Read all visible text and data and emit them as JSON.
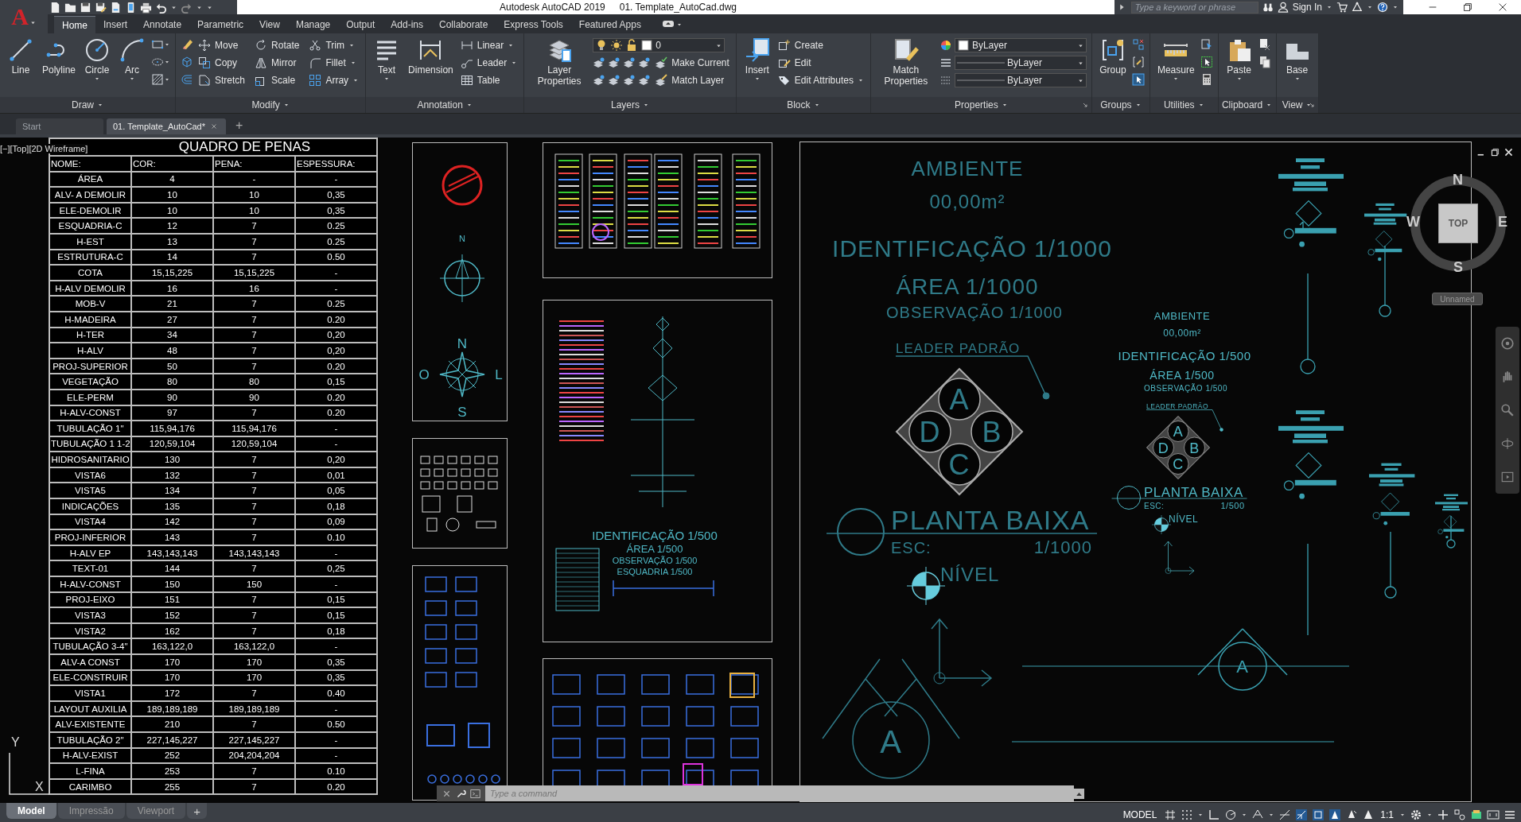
{
  "app_button": {
    "label": "A"
  },
  "title_bar": {
    "app_title": "Autodesk AutoCAD 2019",
    "document": "01. Template_AutoCad.dwg",
    "search": {
      "placeholder": "Type a keyword or phrase"
    },
    "sign_in": "Sign In"
  },
  "ribbon_tabs": [
    {
      "label": "Home",
      "selected": true
    },
    {
      "label": "Insert",
      "selected": false
    },
    {
      "label": "Annotate",
      "selected": false
    },
    {
      "label": "Parametric",
      "selected": false
    },
    {
      "label": "View",
      "selected": false
    },
    {
      "label": "Manage",
      "selected": false
    },
    {
      "label": "Output",
      "selected": false
    },
    {
      "label": "Add-ins",
      "selected": false
    },
    {
      "label": "Collaborate",
      "selected": false
    },
    {
      "label": "Express Tools",
      "selected": false
    },
    {
      "label": "Featured Apps",
      "selected": false
    }
  ],
  "ribbon_panels": [
    {
      "title": "Draw",
      "tools": [
        {
          "kind": "large",
          "label": "Line",
          "dropdown": false
        },
        {
          "kind": "large",
          "label": "Polyline",
          "dropdown": false
        },
        {
          "kind": "large",
          "label": "Circle",
          "dropdown": true
        },
        {
          "kind": "large",
          "label": "Arc",
          "dropdown": true
        }
      ]
    },
    {
      "title": "Modify",
      "tools": [
        {
          "kind": "small",
          "label": "Move",
          "dropdown": false
        },
        {
          "kind": "small",
          "label": "Rotate",
          "dropdown": false
        },
        {
          "kind": "small",
          "label": "Trim",
          "dropdown": true
        },
        {
          "kind": "small",
          "label": "Copy",
          "dropdown": false
        },
        {
          "kind": "small",
          "label": "Mirror",
          "dropdown": false
        },
        {
          "kind": "small",
          "label": "Fillet",
          "dropdown": true
        },
        {
          "kind": "small",
          "label": "Stretch",
          "dropdown": false
        },
        {
          "kind": "small",
          "label": "Scale",
          "dropdown": false
        },
        {
          "kind": "small",
          "label": "Array",
          "dropdown": true
        }
      ]
    },
    {
      "title": "Annotation",
      "tools": [
        {
          "kind": "large",
          "label": "Text",
          "dropdown": true
        },
        {
          "kind": "large",
          "label": "Dimension",
          "dropdown": false
        },
        {
          "kind": "small",
          "label": "Linear",
          "dropdown": true
        },
        {
          "kind": "small",
          "label": "Leader",
          "dropdown": true
        },
        {
          "kind": "small",
          "label": "Table",
          "dropdown": false
        }
      ]
    },
    {
      "title": "Layers",
      "tools": [
        {
          "kind": "large",
          "label": "Layer Properties",
          "dropdown": false
        },
        {
          "kind": "combo",
          "value": "0"
        },
        {
          "kind": "small",
          "label": "Make Current",
          "dropdown": false
        },
        {
          "kind": "small",
          "label": "Match Layer",
          "dropdown": false
        }
      ]
    },
    {
      "title": "Block",
      "tools": [
        {
          "kind": "large",
          "label": "Insert",
          "dropdown": true
        },
        {
          "kind": "small",
          "label": "Create",
          "dropdown": false
        },
        {
          "kind": "small",
          "label": "Edit",
          "dropdown": false
        },
        {
          "kind": "small",
          "label": "Edit Attributes",
          "dropdown": true
        }
      ]
    },
    {
      "title": "Properties",
      "tools": [
        {
          "kind": "large",
          "label": "Match Properties",
          "dropdown": false
        },
        {
          "kind": "combo",
          "value": "ByLayer"
        },
        {
          "kind": "combo",
          "value": "ByLayer"
        },
        {
          "kind": "combo",
          "value": "ByLayer"
        }
      ]
    },
    {
      "title": "Groups",
      "tools": [
        {
          "kind": "large",
          "label": "Group",
          "dropdown": false
        }
      ]
    },
    {
      "title": "Utilities",
      "tools": [
        {
          "kind": "large",
          "label": "Measure",
          "dropdown": true
        }
      ]
    },
    {
      "title": "Clipboard",
      "tools": [
        {
          "kind": "large",
          "label": "Paste",
          "dropdown": true
        }
      ]
    },
    {
      "title": "View",
      "tools": [
        {
          "kind": "large",
          "label": "Base",
          "dropdown": true
        }
      ]
    }
  ],
  "document_tabs": [
    {
      "label": "Start",
      "selected": false,
      "closable": false
    },
    {
      "label": "01. Template_AutoCad*",
      "selected": true,
      "closable": true
    }
  ],
  "new_tab": "+",
  "viewport_label": "[−][Top][2D Wireframe]",
  "table": {
    "title": "QUADRO DE PENAS",
    "columns": [
      "NOME:",
      "COR:",
      "PENA:",
      "ESPESSURA:"
    ],
    "rows": [
      {
        "nome": "ÁREA",
        "cor": "4",
        "pena": "-",
        "espessura": "-"
      },
      {
        "nome": "ALV- A DEMOLIR",
        "cor": "10",
        "pena": "10",
        "espessura": "0,35"
      },
      {
        "nome": "ELE-DEMOLIR",
        "cor": "10",
        "pena": "10",
        "espessura": "0,35"
      },
      {
        "nome": "ESQUADRIA-C",
        "cor": "12",
        "pena": "7",
        "espessura": "0.25"
      },
      {
        "nome": "H-EST",
        "cor": "13",
        "pena": "7",
        "espessura": "0.25"
      },
      {
        "nome": "ESTRUTURA-C",
        "cor": "14",
        "pena": "7",
        "espessura": "0.50"
      },
      {
        "nome": "COTA",
        "cor": "15,15,225",
        "pena": "15,15,225",
        "espessura": "-"
      },
      {
        "nome": "H-ALV DEMOLIR",
        "cor": "16",
        "pena": "16",
        "espessura": "-"
      },
      {
        "nome": "MOB-V",
        "cor": "21",
        "pena": "7",
        "espessura": "0.25"
      },
      {
        "nome": "H-MADEIRA",
        "cor": "27",
        "pena": "7",
        "espessura": "0.20"
      },
      {
        "nome": "H-TER",
        "cor": "34",
        "pena": "7",
        "espessura": "0,20"
      },
      {
        "nome": "H-ALV",
        "cor": "48",
        "pena": "7",
        "espessura": "0,20"
      },
      {
        "nome": "PROJ-SUPERIOR",
        "cor": "50",
        "pena": "7",
        "espessura": "0.20"
      },
      {
        "nome": "VEGETAÇÃO",
        "cor": "80",
        "pena": "80",
        "espessura": "0,15"
      },
      {
        "nome": "ELE-PERM",
        "cor": "90",
        "pena": "90",
        "espessura": "0.20"
      },
      {
        "nome": "H-ALV-CONST",
        "cor": "97",
        "pena": "7",
        "espessura": "0.20"
      },
      {
        "nome": "TUBULAÇÃO 1\"",
        "cor": "115,94,176",
        "pena": "115,94,176",
        "espessura": "-"
      },
      {
        "nome": "TUBULAÇÃO 1 1-2",
        "cor": "120,59,104",
        "pena": "120,59,104",
        "espessura": "-"
      },
      {
        "nome": "HIDROSANITARIO",
        "cor": "130",
        "pena": "7",
        "espessura": "0,20"
      },
      {
        "nome": "VISTA6",
        "cor": "132",
        "pena": "7",
        "espessura": "0,01"
      },
      {
        "nome": "VISTA5",
        "cor": "134",
        "pena": "7",
        "espessura": "0,05"
      },
      {
        "nome": "INDICAÇÕES",
        "cor": "135",
        "pena": "7",
        "espessura": "0,18"
      },
      {
        "nome": "VISTA4",
        "cor": "142",
        "pena": "7",
        "espessura": "0,09"
      },
      {
        "nome": "PROJ-INFERIOR",
        "cor": "143",
        "pena": "7",
        "espessura": "0.10"
      },
      {
        "nome": "H-ALV EP",
        "cor": "143,143,143",
        "pena": "143,143,143",
        "espessura": "-"
      },
      {
        "nome": "TEXT-01",
        "cor": "144",
        "pena": "7",
        "espessura": "0,25"
      },
      {
        "nome": "H-ALV-CONST",
        "cor": "150",
        "pena": "150",
        "espessura": "-"
      },
      {
        "nome": "PROJ-EIXO",
        "cor": "151",
        "pena": "7",
        "espessura": "0,15"
      },
      {
        "nome": "VISTA3",
        "cor": "152",
        "pena": "7",
        "espessura": "0,15"
      },
      {
        "nome": "VISTA2",
        "cor": "162",
        "pena": "7",
        "espessura": "0,18"
      },
      {
        "nome": "TUBULAÇÃO 3-4\"",
        "cor": "163,122,0",
        "pena": "163,122,0",
        "espessura": "-"
      },
      {
        "nome": "ALV-A CONST",
        "cor": "170",
        "pena": "170",
        "espessura": "0,35"
      },
      {
        "nome": "ELE-CONSTRUIR",
        "cor": "170",
        "pena": "170",
        "espessura": "0,35"
      },
      {
        "nome": "VISTA1",
        "cor": "172",
        "pena": "7",
        "espessura": "0.40"
      },
      {
        "nome": "LAYOUT AUXILIA",
        "cor": "189,189,189",
        "pena": "189,189,189",
        "espessura": "-"
      },
      {
        "nome": "ALV-EXISTENTE",
        "cor": "210",
        "pena": "7",
        "espessura": "0.50"
      },
      {
        "nome": "TUBULAÇÃO 2\"",
        "cor": "227,145,227",
        "pena": "227,145,227",
        "espessura": "-"
      },
      {
        "nome": "H-ALV-EXIST",
        "cor": "252",
        "pena": "204,204,204",
        "espessura": "-"
      },
      {
        "nome": "L-FINA",
        "cor": "253",
        "pena": "7",
        "espessura": "0.10"
      },
      {
        "nome": "CARIMBO",
        "cor": "255",
        "pena": "7",
        "espessura": "0.20"
      }
    ]
  },
  "ucs": {
    "y_label": "Y",
    "x_label": "X"
  },
  "symbol_sheet": {
    "north_label": "N",
    "compass": [
      "N",
      "O",
      "L",
      "S"
    ]
  },
  "template_sheet": {
    "labels": [
      "IDENTIFICAÇÃO 1/500",
      "ÁREA 1/500",
      "OBSERVAÇÃO 1/500",
      "ESQUADRIA 1/500"
    ]
  },
  "tags": [
    {
      "room": "AMBIENTE",
      "area": "00,00m²",
      "identification": "IDENTIFICAÇÃO 1/1000",
      "area_scale": "ÁREA 1/1000",
      "observation": "OBSERVAÇÃO 1/1000",
      "leader": "LEADER PADRÃO",
      "letters": [
        "A",
        "B",
        "C",
        "D"
      ],
      "title": "PLANTA BAIXA",
      "scale_label": "ESC:",
      "scale": "1/1000",
      "level": "NÍVEL"
    },
    {
      "room": "AMBIENTE",
      "area": "00,00m²",
      "identification": "IDENTIFICAÇÃO 1/500",
      "area_scale": "ÁREA 1/500",
      "observation": "OBSERVAÇÃO 1/500",
      "leader": "LEADER PADRÃO",
      "letters": [
        "A",
        "B",
        "C",
        "D"
      ],
      "title": "PLANTA BAIXA",
      "scale_label": "ESC:",
      "scale": "1/500",
      "level": "NÍVEL"
    }
  ],
  "section_markers": [
    "A",
    "A"
  ],
  "view_cube": {
    "north": "N",
    "west": "W",
    "east": "E",
    "south": "S",
    "face": "TOP",
    "coordinate_system": "Unnamed"
  },
  "command_line": {
    "placeholder": "Type a command"
  },
  "layout_tabs": [
    {
      "label": "Model",
      "selected": true
    },
    {
      "label": "Impressão",
      "selected": false
    },
    {
      "label": "Viewport",
      "selected": false
    }
  ],
  "add_layout": "+",
  "status_bar": {
    "space": "MODEL",
    "annotation_scale": "1:1"
  }
}
